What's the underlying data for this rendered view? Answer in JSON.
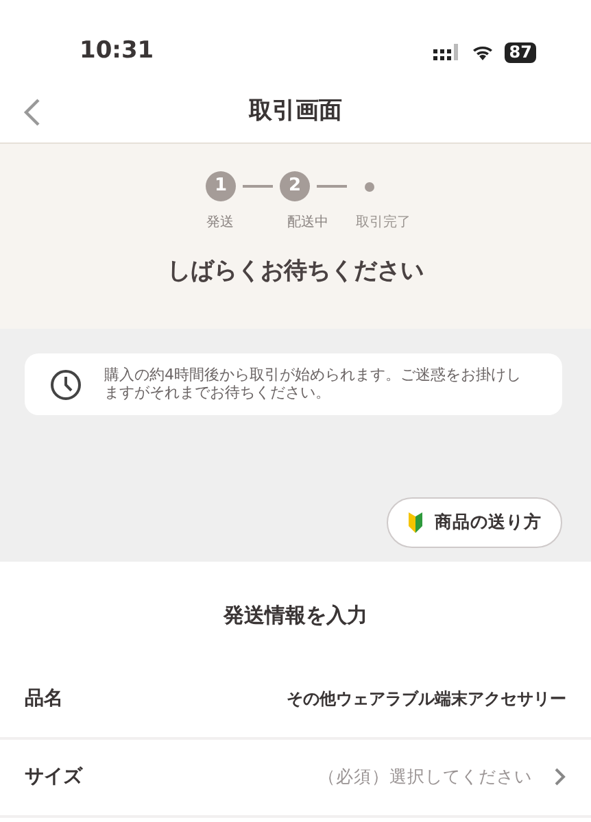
{
  "status_bar": {
    "time": "10:31",
    "battery": "87"
  },
  "nav": {
    "title": "取引画面"
  },
  "progress": {
    "steps": [
      {
        "number": "1",
        "label": "発送",
        "reached": true
      },
      {
        "number": "2",
        "label": "配送中",
        "reached": true
      },
      {
        "label": "取引完了",
        "reached": false
      }
    ],
    "heading": "しばらくお待ちください"
  },
  "notice": {
    "text": "購入の約4時間後から取引が始められます。ご迷惑をお掛けしますがそれまでお待ちください。"
  },
  "guide_button": {
    "label": "商品の送り方"
  },
  "shipping": {
    "heading": "発送情報を入力",
    "rows": [
      {
        "kind": "value",
        "label": "品名",
        "value": "その他ウェアラブル端末アクセサリー"
      },
      {
        "kind": "select",
        "label": "サイズ",
        "value": "（必須）選択してください"
      }
    ]
  }
}
